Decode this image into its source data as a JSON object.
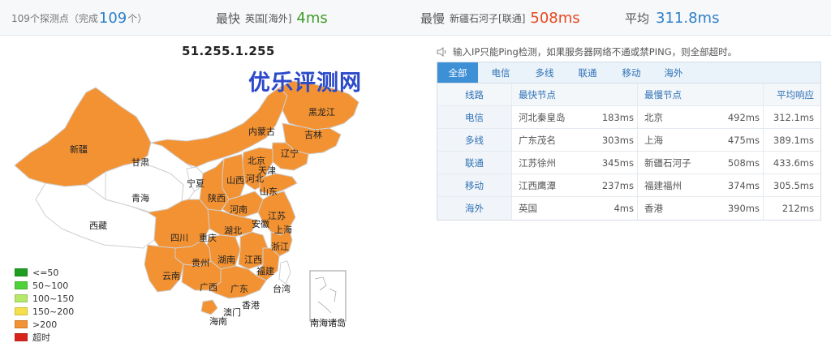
{
  "summary": {
    "probe_count": "109个探测点（完成",
    "probe_done": "109",
    "probe_suffix": "个）",
    "fastest_label": "最快",
    "fastest_node": "英国[海外]",
    "fastest_value": "4ms",
    "slowest_label": "最慢",
    "slowest_node": "新疆石河子[联通]",
    "slowest_value": "508ms",
    "average_label": "平均",
    "average_value": "311.8ms"
  },
  "map": {
    "ip": "51.255.1.255",
    "watermark": "优乐评测网",
    "provinces": {
      "heilongjiang": "黑龙江",
      "jilin": "吉林",
      "liaoning": "辽宁",
      "neimenggu": "内蒙古",
      "beijing": "北京",
      "tianjin": "天津",
      "hebei": "河北",
      "shanxi": "山西",
      "shandong": "山东",
      "xinjiang": "新疆",
      "gansu": "甘肃",
      "ningxia": "宁夏",
      "qinghai": "青海",
      "shaanxi": "陕西",
      "henan": "河南",
      "jiangsu": "江苏",
      "anhui": "安徽",
      "shanghai": "上海",
      "xizang": "西藏",
      "sichuan": "四川",
      "chongqing": "重庆",
      "hubei": "湖北",
      "zhejiang": "浙江",
      "guizhou": "贵州",
      "hunan": "湖南",
      "jiangxi": "江西",
      "yunnan": "云南",
      "guangxi": "广西",
      "guangdong": "广东",
      "fujian": "福建",
      "taiwan": "台湾",
      "xianggang": "香港",
      "aomen": "澳门",
      "hainan": "海南",
      "nanhai": "南海诸岛"
    },
    "legend": [
      {
        "label": "<=50",
        "color": "#1e9e1e"
      },
      {
        "label": "50~100",
        "color": "#4fd13a"
      },
      {
        "label": "100~150",
        "color": "#b6e86a"
      },
      {
        "label": "150~200",
        "color": "#f4e04d"
      },
      {
        "label": ">200",
        "color": "#f39232"
      },
      {
        "label": "超时",
        "color": "#d9241b"
      }
    ],
    "colors": {
      "slow": "#f39232",
      "none": "#ffffff",
      "border": "#cfcfcf"
    }
  },
  "notice": "输入IP只能Ping检测，如果服务器网络不通或禁PING，则全部超时。",
  "tabs": [
    "全部",
    "电信",
    "多线",
    "联通",
    "移动",
    "海外"
  ],
  "table": {
    "headers": {
      "line": "线路",
      "fastest": "最快节点",
      "slowest": "最慢节点",
      "avg": "平均响应"
    },
    "rows": [
      {
        "line": "电信",
        "fast_node": "河北秦皇岛",
        "fast_ms": "183ms",
        "slow_node": "北京",
        "slow_ms": "492ms",
        "avg": "312.1ms"
      },
      {
        "line": "多线",
        "fast_node": "广东茂名",
        "fast_ms": "303ms",
        "slow_node": "上海",
        "slow_ms": "475ms",
        "avg": "389.1ms"
      },
      {
        "line": "联通",
        "fast_node": "江苏徐州",
        "fast_ms": "345ms",
        "slow_node": "新疆石河子",
        "slow_ms": "508ms",
        "avg": "433.6ms"
      },
      {
        "line": "移动",
        "fast_node": "江西鹰潭",
        "fast_ms": "237ms",
        "slow_node": "福建福州",
        "slow_ms": "374ms",
        "avg": "305.5ms"
      },
      {
        "line": "海外",
        "fast_node": "英国",
        "fast_ms": "4ms",
        "slow_node": "香港",
        "slow_ms": "390ms",
        "avg": "212ms"
      }
    ]
  }
}
